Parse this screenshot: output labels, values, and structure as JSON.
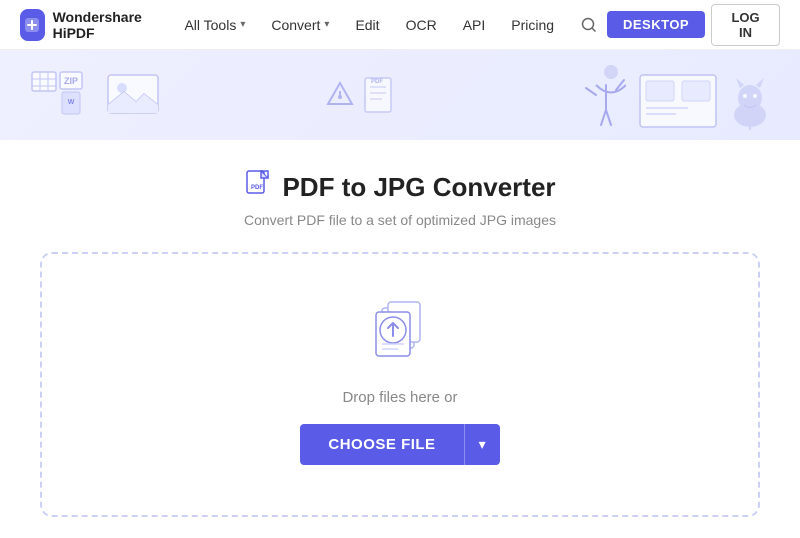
{
  "brand": {
    "name": "Wondershare HiPDF",
    "logo_bg": "#5a5ce8"
  },
  "nav": {
    "all_tools_label": "All Tools",
    "convert_label": "Convert",
    "edit_label": "Edit",
    "ocr_label": "OCR",
    "api_label": "API",
    "pricing_label": "Pricing",
    "desktop_btn": "DESKTOP",
    "login_btn": "LOG IN"
  },
  "page": {
    "title": "PDF to JPG Converter",
    "subtitle": "Convert PDF file to a set of optimized JPG images",
    "drop_text": "Drop files here or",
    "choose_file_btn": "CHOOSE FILE",
    "dropdown_arrow": "▾"
  }
}
